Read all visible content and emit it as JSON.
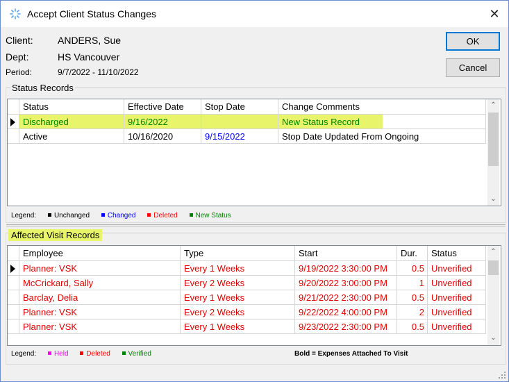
{
  "window": {
    "title": "Accept Client Status Changes",
    "close_glyph": "✕"
  },
  "header": {
    "client_label": "Client:",
    "client_value": "ANDERS, Sue",
    "dept_label": "Dept:",
    "dept_value": "HS Vancouver",
    "period_label": "Period:",
    "period_value": "9/7/2022 - 11/10/2022"
  },
  "buttons": {
    "ok": "OK",
    "cancel": "Cancel"
  },
  "status_records": {
    "title": "Status Records",
    "columns": [
      "Status",
      "Effective Date",
      "Stop Date",
      "Change Comments"
    ],
    "rows": [
      {
        "status": "Discharged",
        "effective": "9/16/2022",
        "stop": "",
        "comments": "New Status Record",
        "color": "#008000",
        "highlight": true
      },
      {
        "status": "Active",
        "effective": "10/16/2020",
        "stop": "9/15/2022",
        "comments": "Stop Date Updated From Ongoing",
        "color": "#000000",
        "stop_color": "#0000ff",
        "highlight": false
      }
    ],
    "legend_label": "Legend:",
    "legend": [
      {
        "label": "Unchanged",
        "color": "#000000"
      },
      {
        "label": "Changed",
        "color": "#0000ff"
      },
      {
        "label": "Deleted",
        "color": "#ff0000"
      },
      {
        "label": "New Status",
        "color": "#008000"
      }
    ]
  },
  "visit_records": {
    "title": "Affected Visit Records",
    "columns": [
      "Employee",
      "Type",
      "Start",
      "Dur.",
      "Status"
    ],
    "rows": [
      {
        "employee": "Planner: VSK",
        "type": "Every 1 Weeks",
        "start": "9/19/2022 3:30:00 PM",
        "dur": "0.5",
        "status": "Unverified"
      },
      {
        "employee": "McCrickard, Sally",
        "type": "Every 2 Weeks",
        "start": "9/20/2022 3:00:00 PM",
        "dur": "1",
        "status": "Unverified"
      },
      {
        "employee": "Barclay, Delia",
        "type": "Every 1 Weeks",
        "start": "9/21/2022 2:30:00 PM",
        "dur": "0.5",
        "status": "Unverified"
      },
      {
        "employee": "Planner: VSK",
        "type": "Every 2 Weeks",
        "start": "9/22/2022 4:00:00 PM",
        "dur": "2",
        "status": "Unverified"
      },
      {
        "employee": "Planner: VSK",
        "type": "Every 1 Weeks",
        "start": "9/23/2022 2:30:00 PM",
        "dur": "0.5",
        "status": "Unverified"
      }
    ],
    "row_color": "#e00000",
    "legend_label": "Legend:",
    "legend": [
      {
        "label": "Held",
        "color": "#ff00ff"
      },
      {
        "label": "Deleted",
        "color": "#ff0000"
      },
      {
        "label": "Verified",
        "color": "#008000"
      }
    ],
    "bold_note": "Bold = Expenses Attached To Visit"
  },
  "colors": {
    "highlight": "#e8f56b",
    "accent": "#0078d7"
  }
}
